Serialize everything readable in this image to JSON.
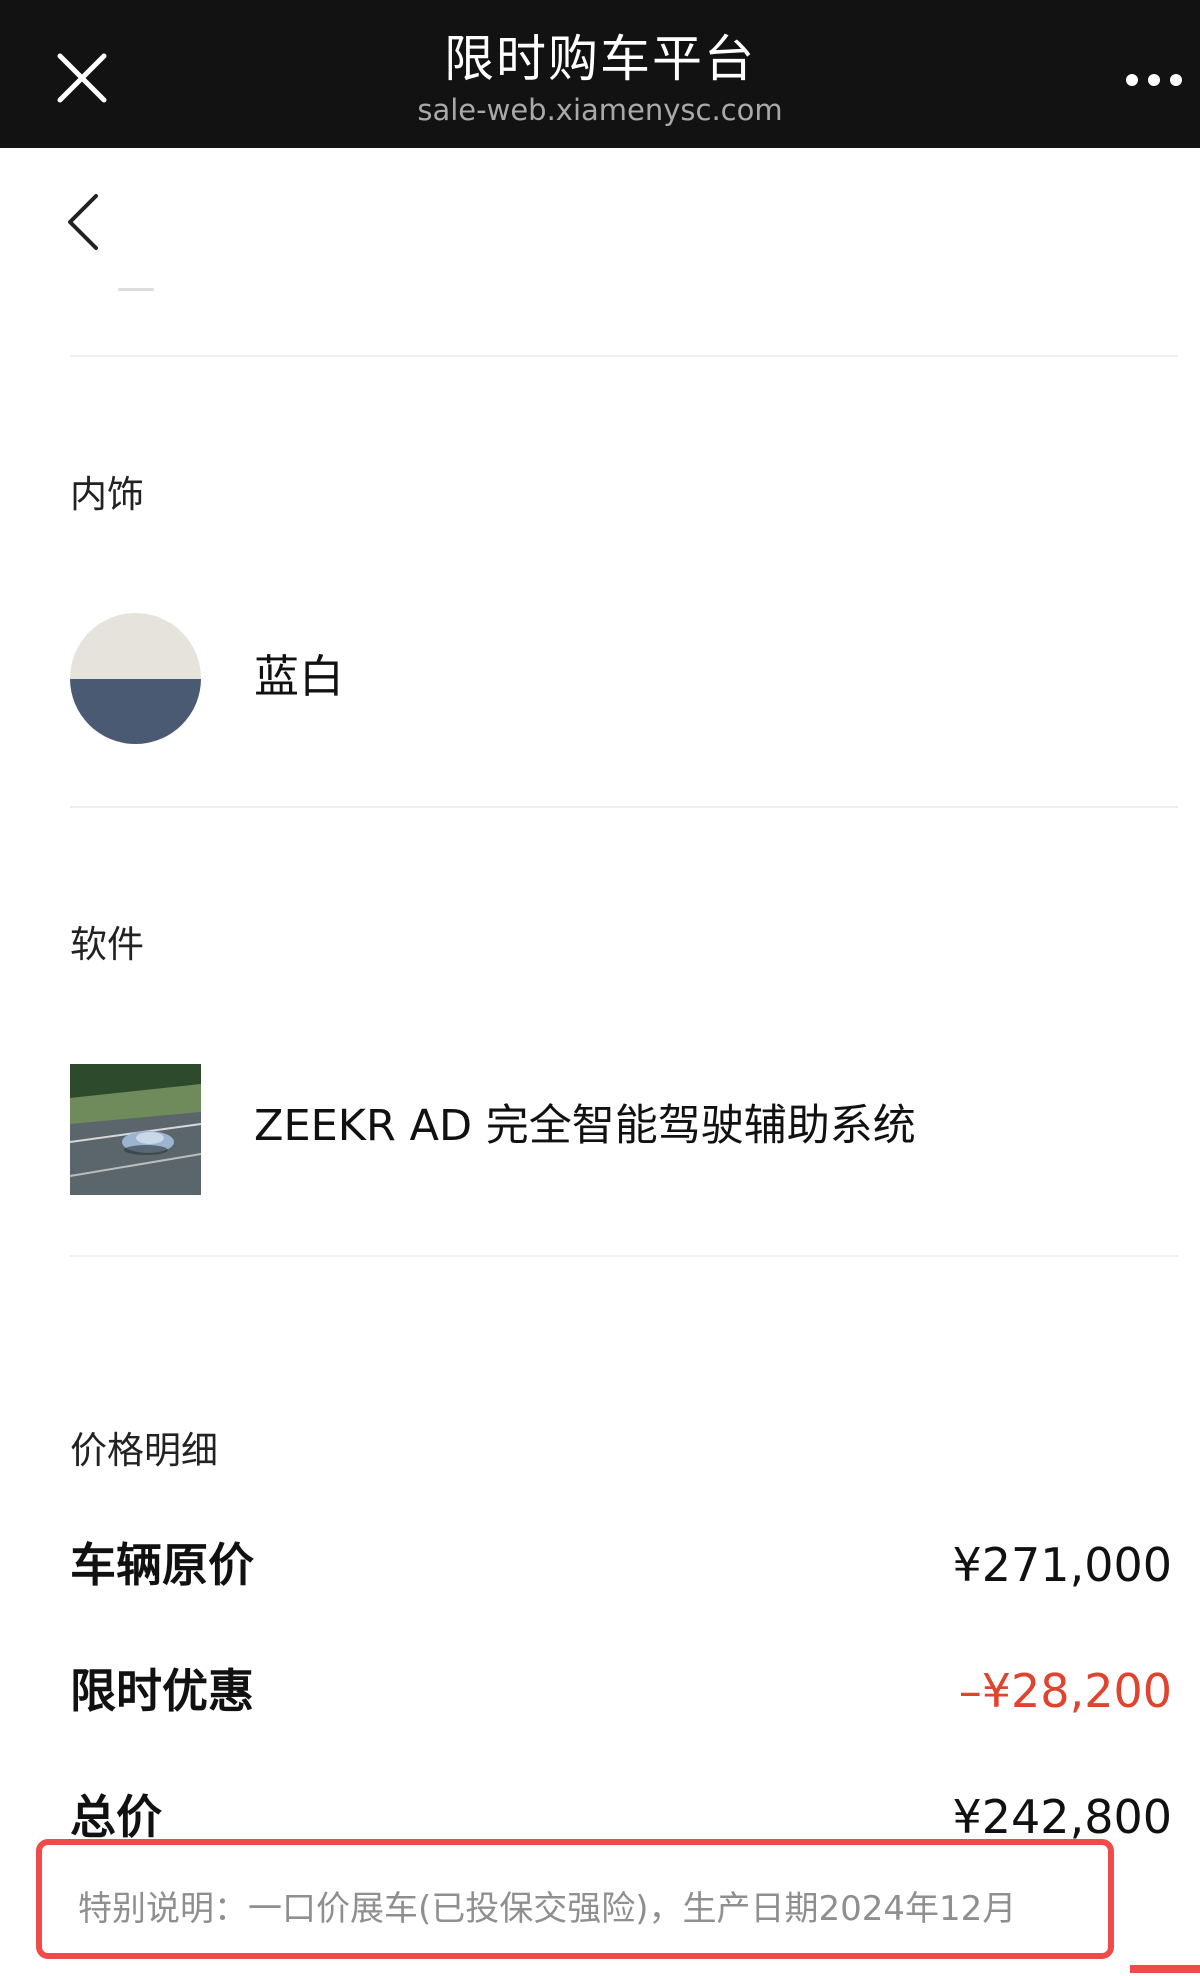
{
  "topbar": {
    "title": "限时购车平台",
    "subtitle": "sale-web.xiamenysc.com",
    "close_icon": "close-icon",
    "more_icon": "more-dots-icon"
  },
  "nav": {
    "back_icon": "chevron-left-icon"
  },
  "interior": {
    "label": "内饰",
    "option": "蓝白",
    "swatch_colors": {
      "top": "#e6e3dd",
      "bottom": "#4a5a72"
    }
  },
  "software": {
    "label": "软件",
    "option": "ZEEKR AD 完全智能驾驶辅助系统",
    "thumb_icon": "car-on-highway-image"
  },
  "price": {
    "label": "价格明细",
    "rows": [
      {
        "label": "车辆原价",
        "value": "¥271,000"
      },
      {
        "label": "限时优惠",
        "value": "–¥28,200"
      },
      {
        "label": "总价",
        "value": "¥242,800"
      }
    ]
  },
  "note": "特别说明：一口价展车(已投保交强险)，生产日期2024年12月",
  "colors": {
    "topbar_bg": "#121212",
    "discount_red": "#e0442f",
    "highlight_border": "#ef4b4b"
  }
}
